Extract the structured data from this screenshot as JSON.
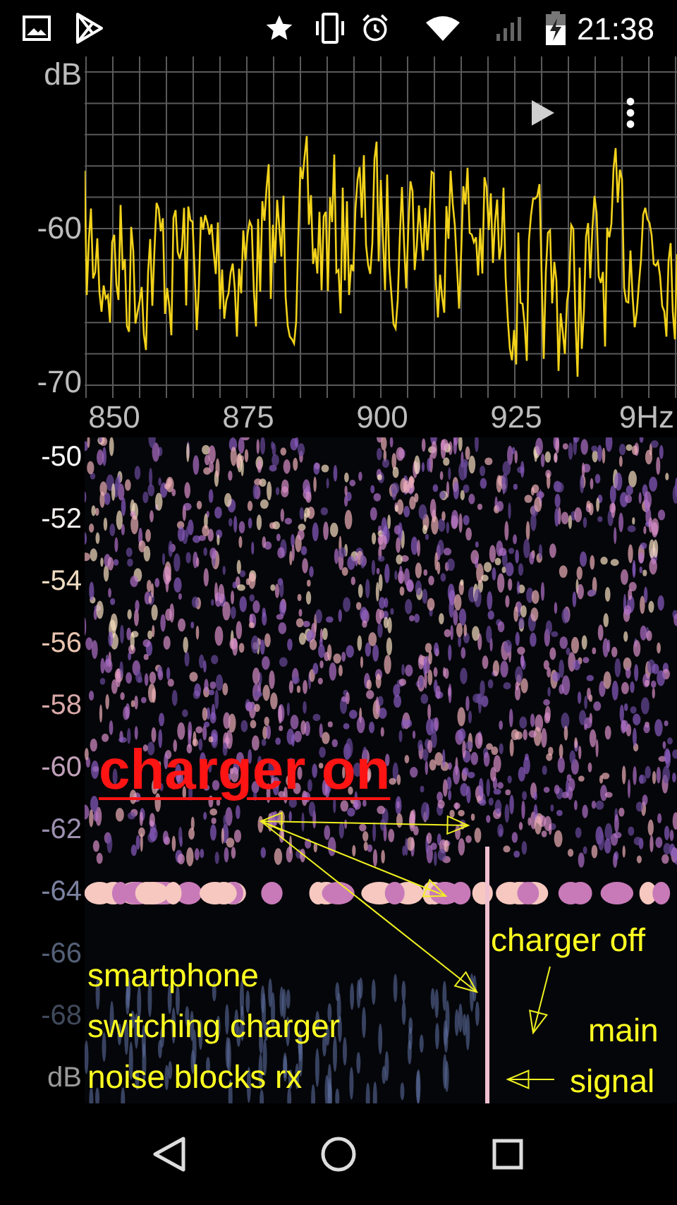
{
  "status_bar": {
    "time": "21:38"
  },
  "spectrum": {
    "y_labels": [
      "dB",
      "-60",
      "-70"
    ],
    "x_labels": [
      "850",
      "875",
      "900",
      "925",
      "9Hz"
    ]
  },
  "waterfall": {
    "y_labels": [
      {
        "text": "-50",
        "color": "#ffffff"
      },
      {
        "text": "-52",
        "color": "#f4f0ee"
      },
      {
        "text": "-54",
        "color": "#efdcc0"
      },
      {
        "text": "-56",
        "color": "#e8c4b0"
      },
      {
        "text": "-58",
        "color": "#d8a8a8"
      },
      {
        "text": "-60",
        "color": "#c0a0b8"
      },
      {
        "text": "-62",
        "color": "#9c90b0"
      },
      {
        "text": "-64",
        "color": "#7c82a0"
      },
      {
        "text": "-66",
        "color": "#546078"
      },
      {
        "text": "-68",
        "color": "#404a5c"
      }
    ],
    "unit": "dB"
  },
  "annotations": [
    {
      "kind": "headline",
      "text": "charger on"
    },
    {
      "kind": "note",
      "text": "charger off"
    },
    {
      "kind": "note",
      "text": "smartphone"
    },
    {
      "kind": "note",
      "text": "switching charger"
    },
    {
      "kind": "note",
      "text": "noise blocks rx"
    },
    {
      "kind": "note",
      "text": "main"
    },
    {
      "kind": "note",
      "text": "signal"
    }
  ]
}
